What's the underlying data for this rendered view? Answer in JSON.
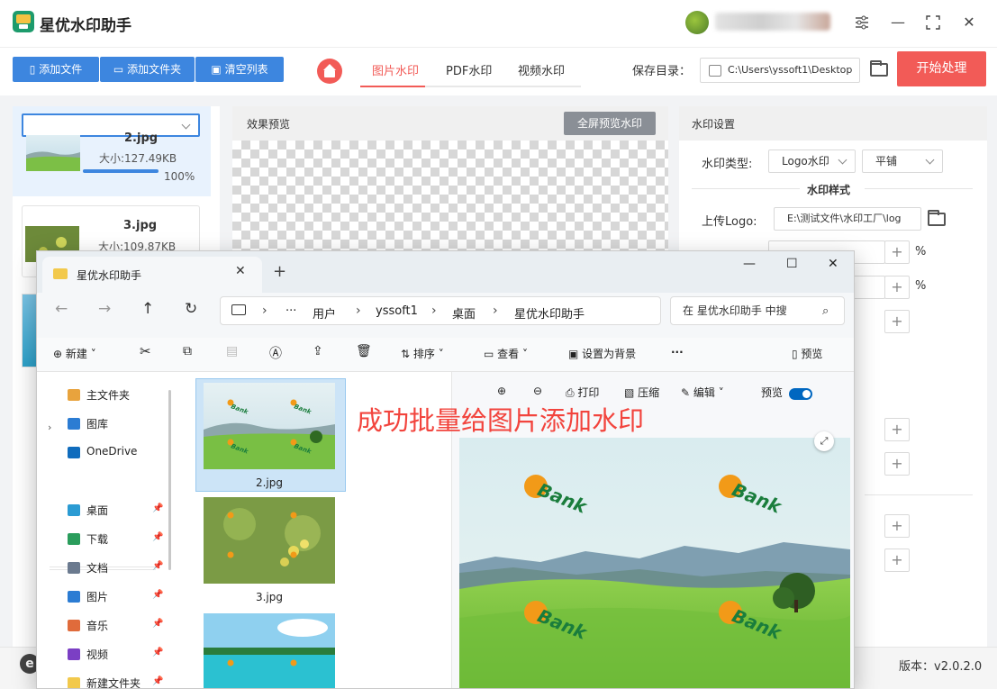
{
  "app": {
    "title": "星优水印助手",
    "version": "版本：v2.0.2.0"
  },
  "toolbar": {
    "add_file": "添加文件",
    "add_folder": "添加文件夹",
    "clear_list": "清空列表",
    "tabs": [
      "图片水印",
      "PDF水印",
      "视频水印"
    ],
    "save_label": "保存目录：",
    "save_path": "C:\\Users\\yssoft1\\Desktop",
    "start": "开始处理"
  },
  "files": [
    {
      "name": "2.jpg",
      "size": "大小:127.49KB",
      "percent": "100%",
      "progress": 100
    },
    {
      "name": "3.jpg",
      "size": "大小:109.87KB"
    }
  ],
  "preview": {
    "title": "效果预览",
    "fullscreen": "全屏预览水印"
  },
  "settings": {
    "title": "水印设置",
    "type_label": "水印类型:",
    "type_value": "Logo水印",
    "mode_value": "平铺",
    "style_title": "水印样式",
    "upload_label": "上传Logo:",
    "upload_path": "E:\\测试文件\\水印工厂\\log",
    "percent": "%"
  },
  "explorer": {
    "tab_title": "星优水印助手",
    "breadcrumb": [
      "用户",
      "yssoft1",
      "桌面",
      "星优水印助手"
    ],
    "search_placeholder": "在 星优水印助手 中搜",
    "commands": {
      "new": "新建",
      "sort": "排序",
      "view": "查看",
      "set_bg": "设置为背景",
      "preview": "预览"
    },
    "sidebar": [
      {
        "label": "主文件夹",
        "color": "#e8a33d"
      },
      {
        "label": "图库",
        "color": "#2b7cd3"
      },
      {
        "label": "OneDrive",
        "color": "#0f6cbd"
      },
      {
        "label": "桌面",
        "color": "#2b9bd3"
      },
      {
        "label": "下载",
        "color": "#2a9d5c"
      },
      {
        "label": "文档",
        "color": "#6b7a8f"
      },
      {
        "label": "图片",
        "color": "#2b7cd3"
      },
      {
        "label": "音乐",
        "color": "#e06b3b"
      },
      {
        "label": "视频",
        "color": "#7b3fc4"
      },
      {
        "label": "新建文件夹",
        "color": "#f2c94c"
      }
    ],
    "thumbs": [
      "2.jpg",
      "3.jpg"
    ],
    "preview_tools": {
      "print": "打印",
      "compress": "压缩",
      "edit": "编辑",
      "preview": "预览"
    },
    "watermark_text": "Bank"
  },
  "annotation": "成功批量给图片添加水印",
  "colors": {
    "accent_blue": "#3d86df",
    "accent_red": "#f25b57",
    "annotation_red": "#f2443d"
  }
}
